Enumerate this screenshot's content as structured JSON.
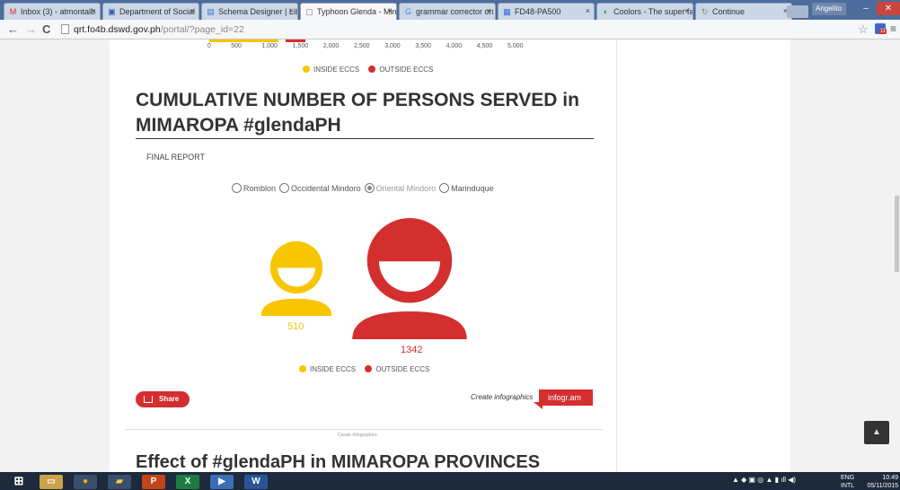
{
  "browser": {
    "tabs": [
      {
        "label": "Inbox (3) - atmontalb",
        "icon": "M",
        "icon_color": "#d93025"
      },
      {
        "label": "Department of Social",
        "icon": "▣",
        "icon_color": "#2a5db0"
      },
      {
        "label": "Schema Designer | Lib",
        "icon": "▤",
        "icon_color": "#3a7bd5"
      },
      {
        "label": "Typhoon Glenda - Min",
        "icon": "▢",
        "icon_color": "#777",
        "active": true
      },
      {
        "label": "grammar corrector on",
        "icon": "G",
        "icon_color": "#4285f4"
      },
      {
        "label": "FD48-PA500",
        "icon": "▦",
        "icon_color": "#2d6cdf"
      },
      {
        "label": "Coolors - The super fa",
        "icon": "◐",
        "icon_color": "#1aa260"
      },
      {
        "label": "Continue",
        "icon": "↻",
        "icon_color": "#888"
      }
    ],
    "profile_name": "Angelito",
    "window_controls": {
      "minimize": "–",
      "maximize": "▫",
      "close": "✕"
    },
    "nav": {
      "back": "←",
      "forward": "→",
      "reload": "C"
    },
    "url_host": "qrt.fo4b.dswd.gov.ph",
    "url_path": "/portal/?page_id=22",
    "extension_badge": "11"
  },
  "page": {
    "top_axis_ticks": [
      "0",
      "500",
      "1,000",
      "1,500",
      "2,000",
      "2,500",
      "3,000",
      "3,500",
      "4,000",
      "4,500",
      "5,000"
    ],
    "top_legend": {
      "inside": "INSIDE ECCS",
      "outside": "OUTSIDE ECCS"
    },
    "title": "CUMULATIVE NUMBER OF PERSONS SERVED in MIMAROPA #glendaPH",
    "subtitle": "FINAL REPORT",
    "provinces": [
      {
        "label": "Romblon",
        "selected": false
      },
      {
        "label": "Occidental Mindoro",
        "selected": false
      },
      {
        "label": "Oriental Mindoro",
        "selected": true
      },
      {
        "label": "Marinduque",
        "selected": false
      }
    ],
    "bottom_legend": {
      "inside": "INSIDE ECCS",
      "outside": "OUTSIDE ECCS"
    },
    "share_label": "Share",
    "create_infographics": "Create infographics",
    "infogram_label": "infogr.am",
    "footer_small": "Create Infographics",
    "next_heading": "Effect of #glendaPH  in MIMAROPA PROVINCES",
    "colors": {
      "inside": "#f7c600",
      "outside": "#d32f2f"
    }
  },
  "chart_data": {
    "type": "pictograph",
    "categories": [
      "INSIDE ECCS",
      "OUTSIDE ECCS"
    ],
    "values": [
      510,
      1342
    ],
    "colors": [
      "#f7c600",
      "#d32f2f"
    ]
  },
  "taskbar": {
    "apps": [
      "start",
      "explorer",
      "chrome",
      "folder",
      "powerpoint",
      "excel",
      "media",
      "word"
    ],
    "lang_top": "ENG",
    "lang_bottom": "INTL",
    "time": "10:49",
    "date": "05/11/2015"
  }
}
